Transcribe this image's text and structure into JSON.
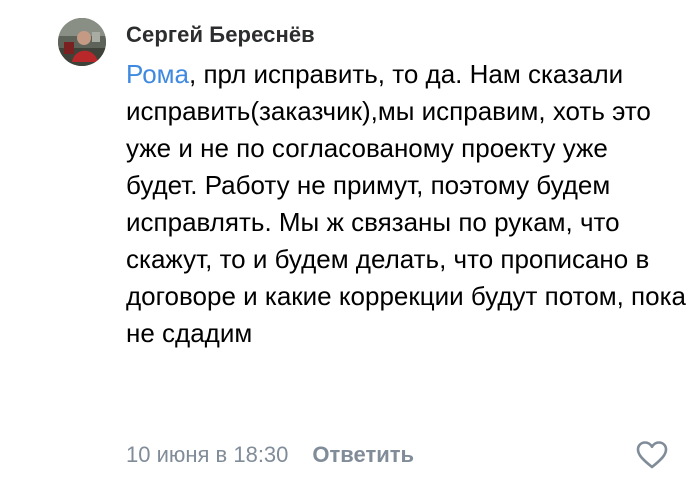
{
  "comment": {
    "author": "Сергей Береснёв",
    "mention": "Рома",
    "text": ", прл исправить, то да. Нам сказали исправить(заказчик),мы исправим, хоть это уже и не по согласованому проекту уже будет. Работу не примут, поэтому будем исправлять. Мы ж связаны по рукам, что скажут, то и будем делать, что прописано в договоре и какие коррекции будут потом, пока не сдадим",
    "date": "10 июня в 18:30",
    "reply_label": "Ответить",
    "like_icon": "heart-outline-icon"
  },
  "colors": {
    "mention": "#3f8ae0",
    "meta": "#818c99",
    "author": "#2c2d2e"
  }
}
